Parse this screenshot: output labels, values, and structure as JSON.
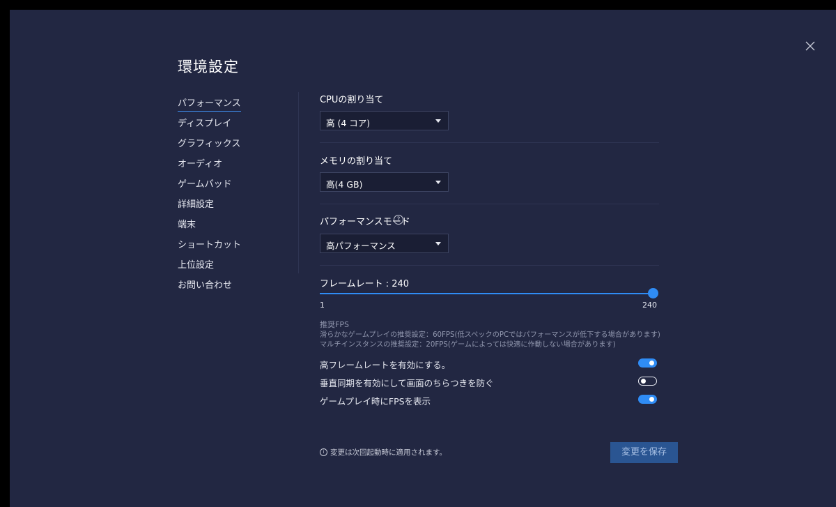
{
  "window": {
    "title": "環境設定"
  },
  "sidebar": {
    "items": [
      {
        "label": "パフォーマンス",
        "active": true
      },
      {
        "label": "ディスプレイ"
      },
      {
        "label": "グラフィックス"
      },
      {
        "label": "オーディオ"
      },
      {
        "label": "ゲームパッド"
      },
      {
        "label": "詳細設定"
      },
      {
        "label": "端末"
      },
      {
        "label": "ショートカット"
      },
      {
        "label": "上位設定"
      },
      {
        "label": "お問い合わせ"
      }
    ]
  },
  "performance": {
    "cpu": {
      "label": "CPUの割り当て",
      "value": "高 (4 コア)"
    },
    "memory": {
      "label": "メモリの割り当て",
      "value": "高(4 GB)"
    },
    "mode": {
      "label": "パフォーマンスモード",
      "value": "高パフォーマンス",
      "help_glyph": "?"
    },
    "frame_rate": {
      "label": "フレームレート : 240",
      "min": "1",
      "max": "240",
      "fill_fraction": 1.0
    },
    "fps_note": {
      "heading": "推奨FPS",
      "text": "滑らかなゲームプレイの推奨設定：60FPS(低スペックのPCではパフォーマンスが低下する場合があります) マルチインスタンスの推奨設定：20FPS(ゲームによっては快適に作動しない場合があります)"
    },
    "toggles": [
      {
        "label": "高フレームレートを有効にする。",
        "on": true
      },
      {
        "label": "垂直同期を有効にして画面のちらつきを防ぐ",
        "on": false
      },
      {
        "label": "ゲームプレイ時にFPSを表示",
        "on": true
      }
    ]
  },
  "footer": {
    "info_glyph": "i",
    "notice": "変更は次回起動時に適用されます。",
    "save_label": "変更を保存"
  },
  "icons": {
    "close": "close-icon",
    "help": "question-circle-icon",
    "info": "info-circle-icon",
    "caret": "caret-down-icon"
  },
  "colors": {
    "background": "#222742",
    "accent": "#2f8cf5",
    "button": "#2a5592"
  }
}
